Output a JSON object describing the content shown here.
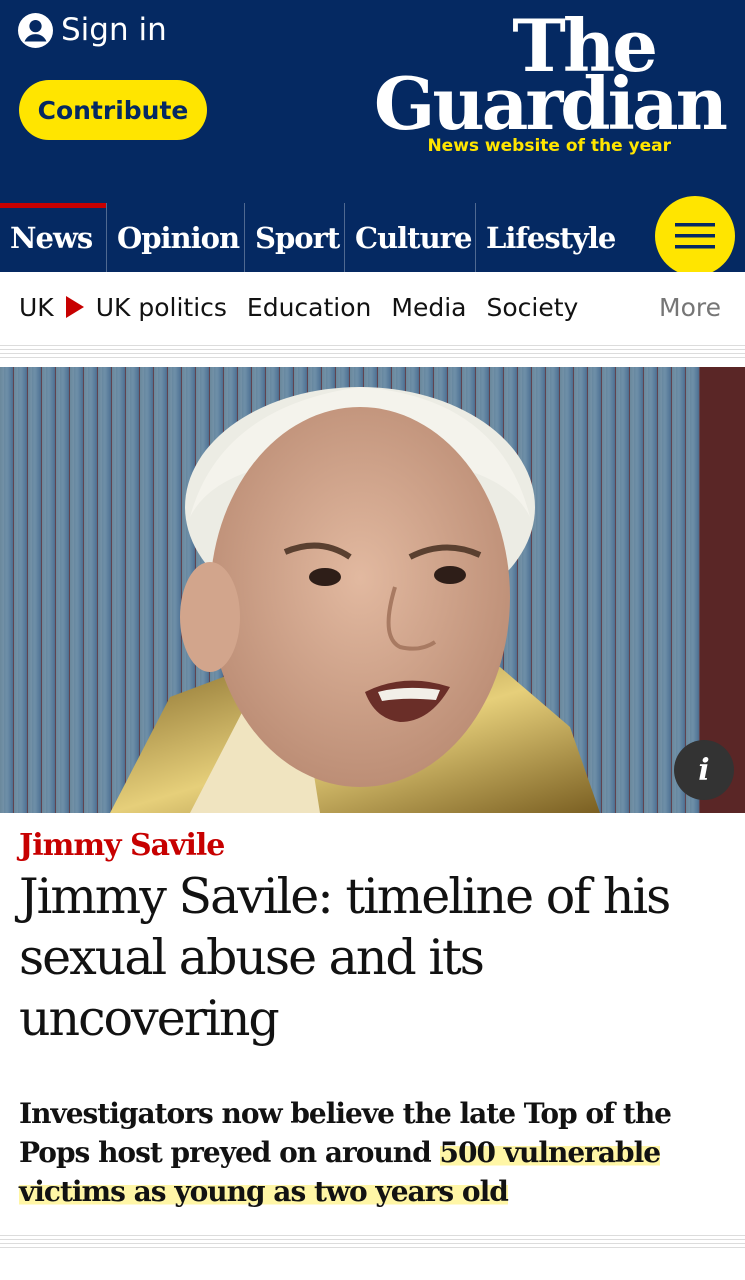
{
  "colors": {
    "brand_navy": "#052962",
    "brand_yellow": "#ffe500",
    "news_red": "#c70000",
    "highlight": "#ffe500"
  },
  "header": {
    "sign_in_label": "Sign in",
    "sign_in_icon": "user-icon",
    "contribute_label": "Contribute",
    "logo_line1": "The",
    "logo_line2": "Guardian",
    "logo_tagline": "News website of the year",
    "menu_icon": "hamburger-icon"
  },
  "pillars": [
    {
      "label": "News",
      "active": true
    },
    {
      "label": "Opinion",
      "active": false
    },
    {
      "label": "Sport",
      "active": false
    },
    {
      "label": "Culture",
      "active": false
    },
    {
      "label": "Lifestyle",
      "active": false
    }
  ],
  "subnav": {
    "items": [
      "UK",
      "UK politics",
      "Education",
      "Media",
      "Society"
    ],
    "more_label": "More"
  },
  "article": {
    "image_alt": "Photo of Jimmy Savile",
    "info_label": "i",
    "kicker": "Jimmy Savile",
    "headline": "Jimmy Savile: timeline of his sexual abuse and its uncovering",
    "standfirst_before": "Investigators now believe the late Top of the Pops host preyed on around ",
    "standfirst_highlight": "500 vulnerable victims as young as two years old"
  }
}
